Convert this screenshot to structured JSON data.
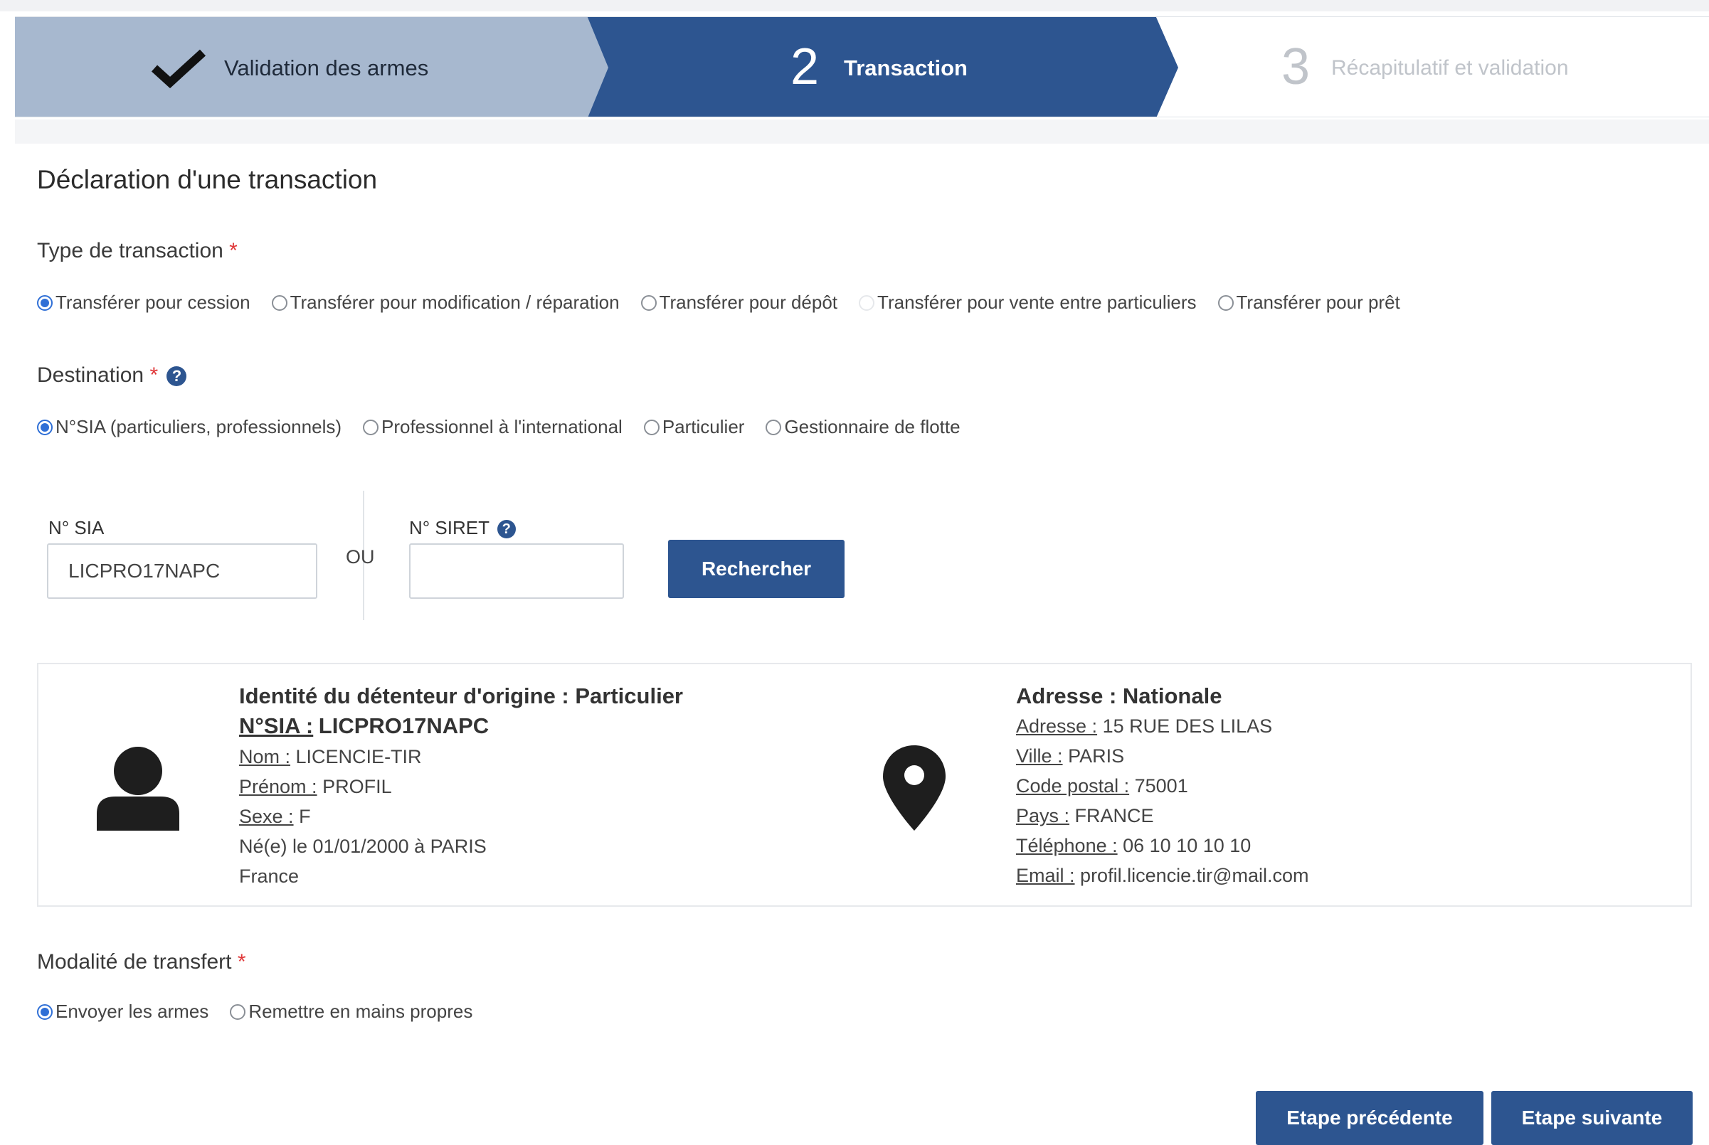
{
  "stepper": {
    "step1": {
      "label": "Validation des armes",
      "state": "completed"
    },
    "step2": {
      "number": "2",
      "label": "Transaction",
      "state": "current"
    },
    "step3": {
      "number": "3",
      "label": "Récapitulatif et validation",
      "state": "upcoming"
    }
  },
  "page_title": "Déclaration d'une transaction",
  "transaction_type": {
    "label": "Type de transaction",
    "required_mark": "*",
    "options": [
      {
        "label": "Transférer pour cession",
        "selected": true
      },
      {
        "label": "Transférer pour modification / réparation",
        "selected": false
      },
      {
        "label": "Transférer pour dépôt",
        "selected": false
      },
      {
        "label": "Transférer pour vente entre particuliers",
        "selected": false,
        "disabled": true
      },
      {
        "label": "Transférer pour prêt",
        "selected": false
      }
    ]
  },
  "destination": {
    "label": "Destination",
    "required_mark": "*",
    "help_icon": "?",
    "options": [
      {
        "label": "N°SIA (particuliers, professionnels)",
        "selected": true
      },
      {
        "label": "Professionnel à l'international",
        "selected": false
      },
      {
        "label": "Particulier",
        "selected": false
      },
      {
        "label": "Gestionnaire de flotte",
        "selected": false
      }
    ]
  },
  "search": {
    "sia_label": "N° SIA",
    "sia_value": "LICPRO17NAPC",
    "or_text": "OU",
    "siret_label": "N° SIRET",
    "siret_help_icon": "?",
    "siret_value": "",
    "button_label": "Rechercher"
  },
  "holder": {
    "heading": "Identité du détenteur d'origine : Particulier",
    "sia_label": "N°SIA :",
    "sia_value": "LICPRO17NAPC",
    "nom_label": "Nom :",
    "nom_value": "LICENCIE-TIR",
    "prenom_label": "Prénom :",
    "prenom_value": "PROFIL",
    "sexe_label": "Sexe :",
    "sexe_value": "F",
    "born_text": "Né(e) le 01/01/2000 à PARIS",
    "country": "France"
  },
  "address": {
    "heading": "Adresse : Nationale",
    "adresse_label": "Adresse :",
    "adresse_value": "15 RUE DES LILAS",
    "ville_label": "Ville :",
    "ville_value": "PARIS",
    "cp_label": "Code postal :",
    "cp_value": "75001",
    "pays_label": "Pays :",
    "pays_value": "FRANCE",
    "tel_label": "Téléphone :",
    "tel_value": "06 10 10 10 10",
    "email_label": "Email :",
    "email_value": "profil.licencie.tir@mail.com"
  },
  "transfer_mode": {
    "label": "Modalité de transfert",
    "required_mark": "*",
    "options": [
      {
        "label": "Envoyer les armes",
        "selected": true
      },
      {
        "label": "Remettre en mains propres",
        "selected": false
      }
    ]
  },
  "footer": {
    "prev_label": "Etape précédente",
    "next_label": "Etape suivante"
  },
  "colors": {
    "primary": "#2d5590",
    "step_completed": "#a7b8cf",
    "radio_selected": "#2f6fd6",
    "required": "#e0383a"
  },
  "icons": [
    "checkmark-icon",
    "help-icon",
    "user-icon",
    "map-pin-icon"
  ]
}
